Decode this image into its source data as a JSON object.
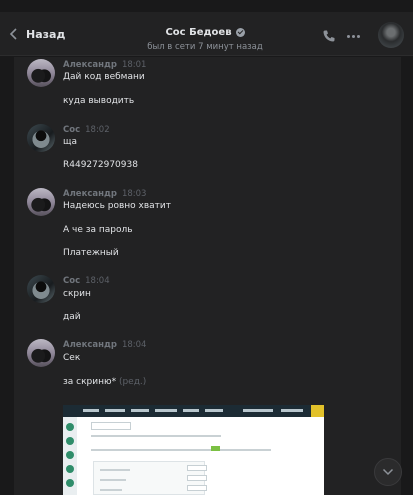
{
  "header": {
    "back_label": "Назад",
    "peer_name": "Сос Бедоев",
    "peer_status": "был в сети 7 минут назад"
  },
  "messages": [
    {
      "author": "Александр",
      "time": "18:01",
      "lines": [
        "Дай код вебмани",
        "куда выводить"
      ]
    },
    {
      "author": "Сос",
      "time": "18:02",
      "lines": [
        "ща",
        "R449272970938"
      ]
    },
    {
      "author": "Александр",
      "time": "18:03",
      "lines": [
        "Надеюсь ровно хватит",
        "А че за пароль",
        "Платежный"
      ]
    },
    {
      "author": "Сос",
      "time": "18:04",
      "lines": [
        "скрин",
        "дай"
      ]
    },
    {
      "author": "Александр",
      "time": "18:04",
      "lines": [
        "Сек",
        "за скриню*"
      ],
      "edited_label": "(ред.)"
    }
  ],
  "icons": {
    "back": "chevron-left-icon",
    "verified": "verified-icon",
    "call": "phone-icon",
    "more": "more-dots-icon",
    "scroll": "chevron-down-icon"
  },
  "colors": {
    "background": "#222223",
    "author_name": "#71767d",
    "text": "#e1e3e6"
  }
}
